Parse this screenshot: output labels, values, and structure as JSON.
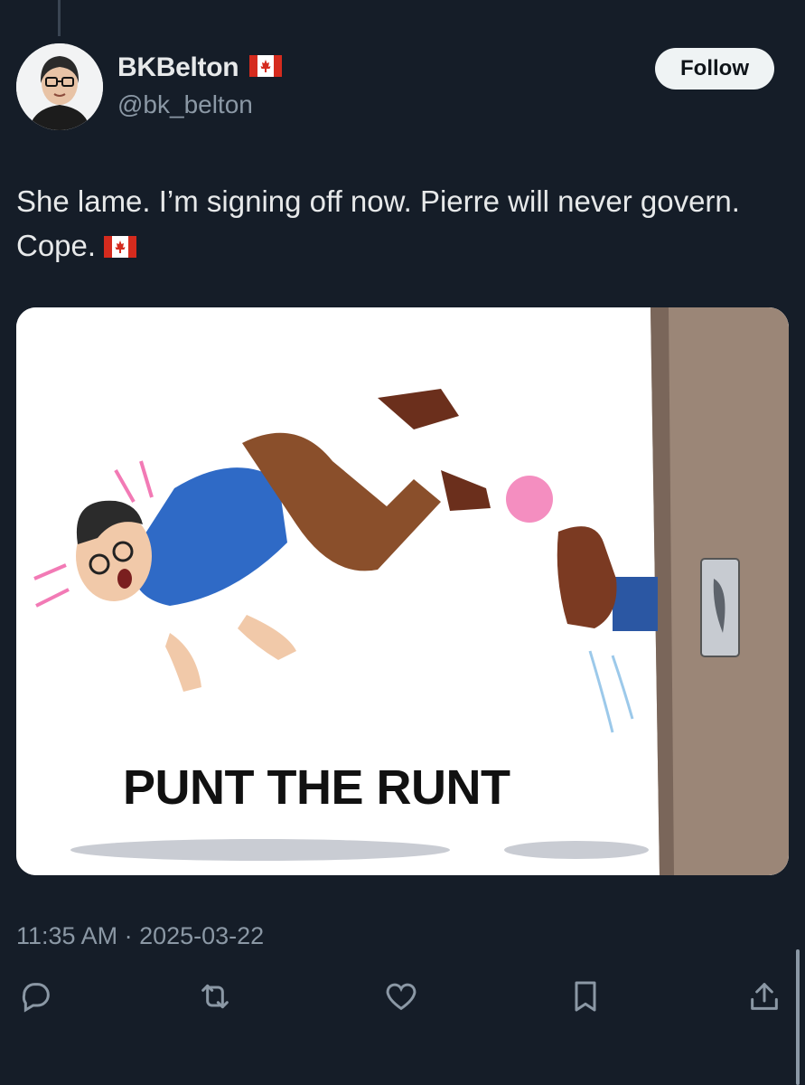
{
  "user": {
    "display_name": "BKBelton",
    "handle": "@bk_belton",
    "flag_icon": "canada-flag-icon"
  },
  "follow_label": "Follow",
  "tweet": {
    "text": "She lame. I’m signing off now. Pierre will never govern. Cope. ",
    "flag_icon": "canada-flag-icon"
  },
  "media": {
    "caption": "PUNT THE RUNT"
  },
  "timestamp": "11:35 AM · 2025-03-22",
  "actions": [
    "reply-icon",
    "retweet-icon",
    "like-icon",
    "bookmark-icon",
    "share-icon"
  ],
  "colors": {
    "background": "#151d28",
    "text": "#e7e9ea",
    "secondary": "#8b98a5",
    "follow_bg": "#eff3f4"
  }
}
